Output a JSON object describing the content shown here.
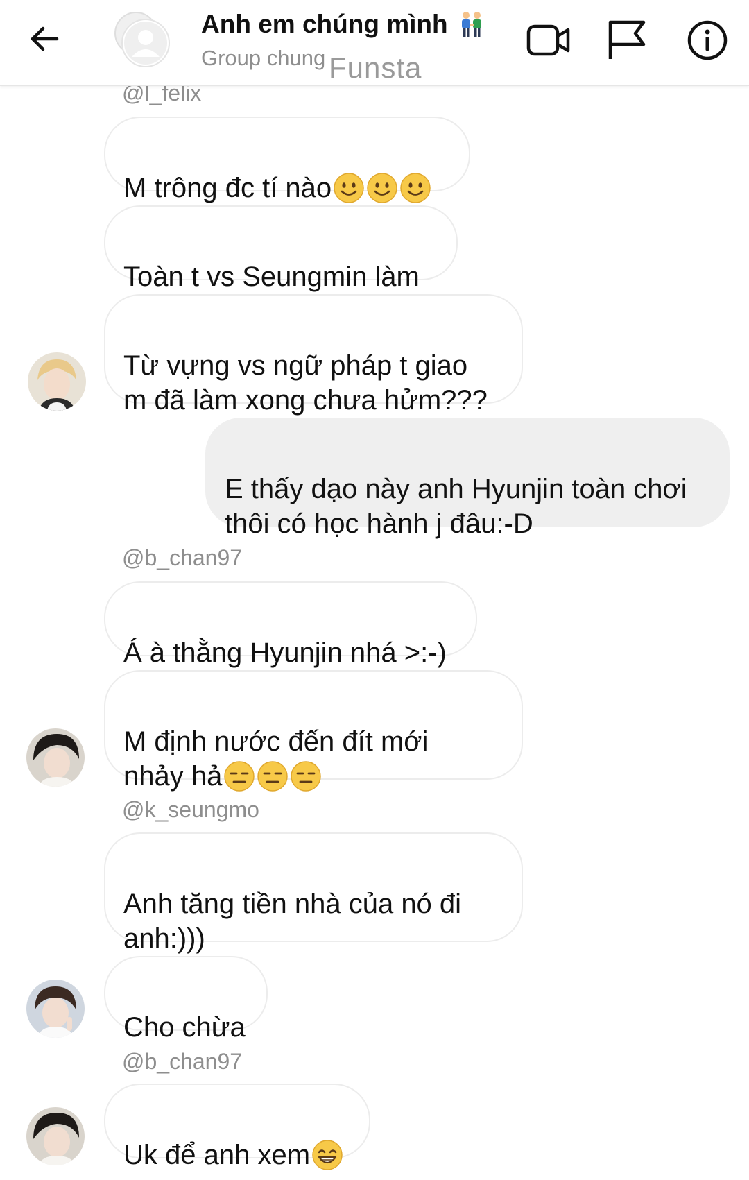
{
  "header": {
    "back_icon": "arrow-left-icon",
    "title": "Anh em chúng mình",
    "title_emoji": "two-men-holding-hands-emoji",
    "subtitle": "Group chung",
    "watermark": "Funsta",
    "icons": [
      "video-camera-icon",
      "flag-icon",
      "info-icon"
    ]
  },
  "messages": [
    {
      "sender": "@l_felix"
    },
    {
      "text": "M trông đc tí nào",
      "emoji": "slightly-smiling-face",
      "emoji_count": 3
    },
    {
      "text": "Toàn t vs Seungmin làm"
    },
    {
      "text": "Từ vựng vs ngữ pháp t giao\nm đã làm xong chưa hửm???"
    },
    {
      "text": "E thấy dạo này anh Hyunjin toàn chơi\nthôi có học hành j đâu:-D",
      "outgoing": true
    },
    {
      "sender": "@b_chan97"
    },
    {
      "text": "Á à thằng Hyunjin nhá >:-)"
    },
    {
      "text": "M định nước đến đít mới\nnhảy hả",
      "emoji": "expressionless-face",
      "emoji_count": 3
    },
    {
      "sender": "@k_seungmo"
    },
    {
      "text": "Anh tăng tiền nhà của nó đi\nanh:)))"
    },
    {
      "text": "Cho chừa"
    },
    {
      "sender": "@b_chan97"
    },
    {
      "text": "Uk để anh xem",
      "emoji": "grinning-face-with-smiling-eyes",
      "emoji_count": 1
    }
  ],
  "colors": {
    "incoming_bubble_border": "#ececec",
    "outgoing_bubble": "#efefef",
    "emoji_yellow": "#f7c948",
    "sender_gray": "#8e8e8e"
  }
}
